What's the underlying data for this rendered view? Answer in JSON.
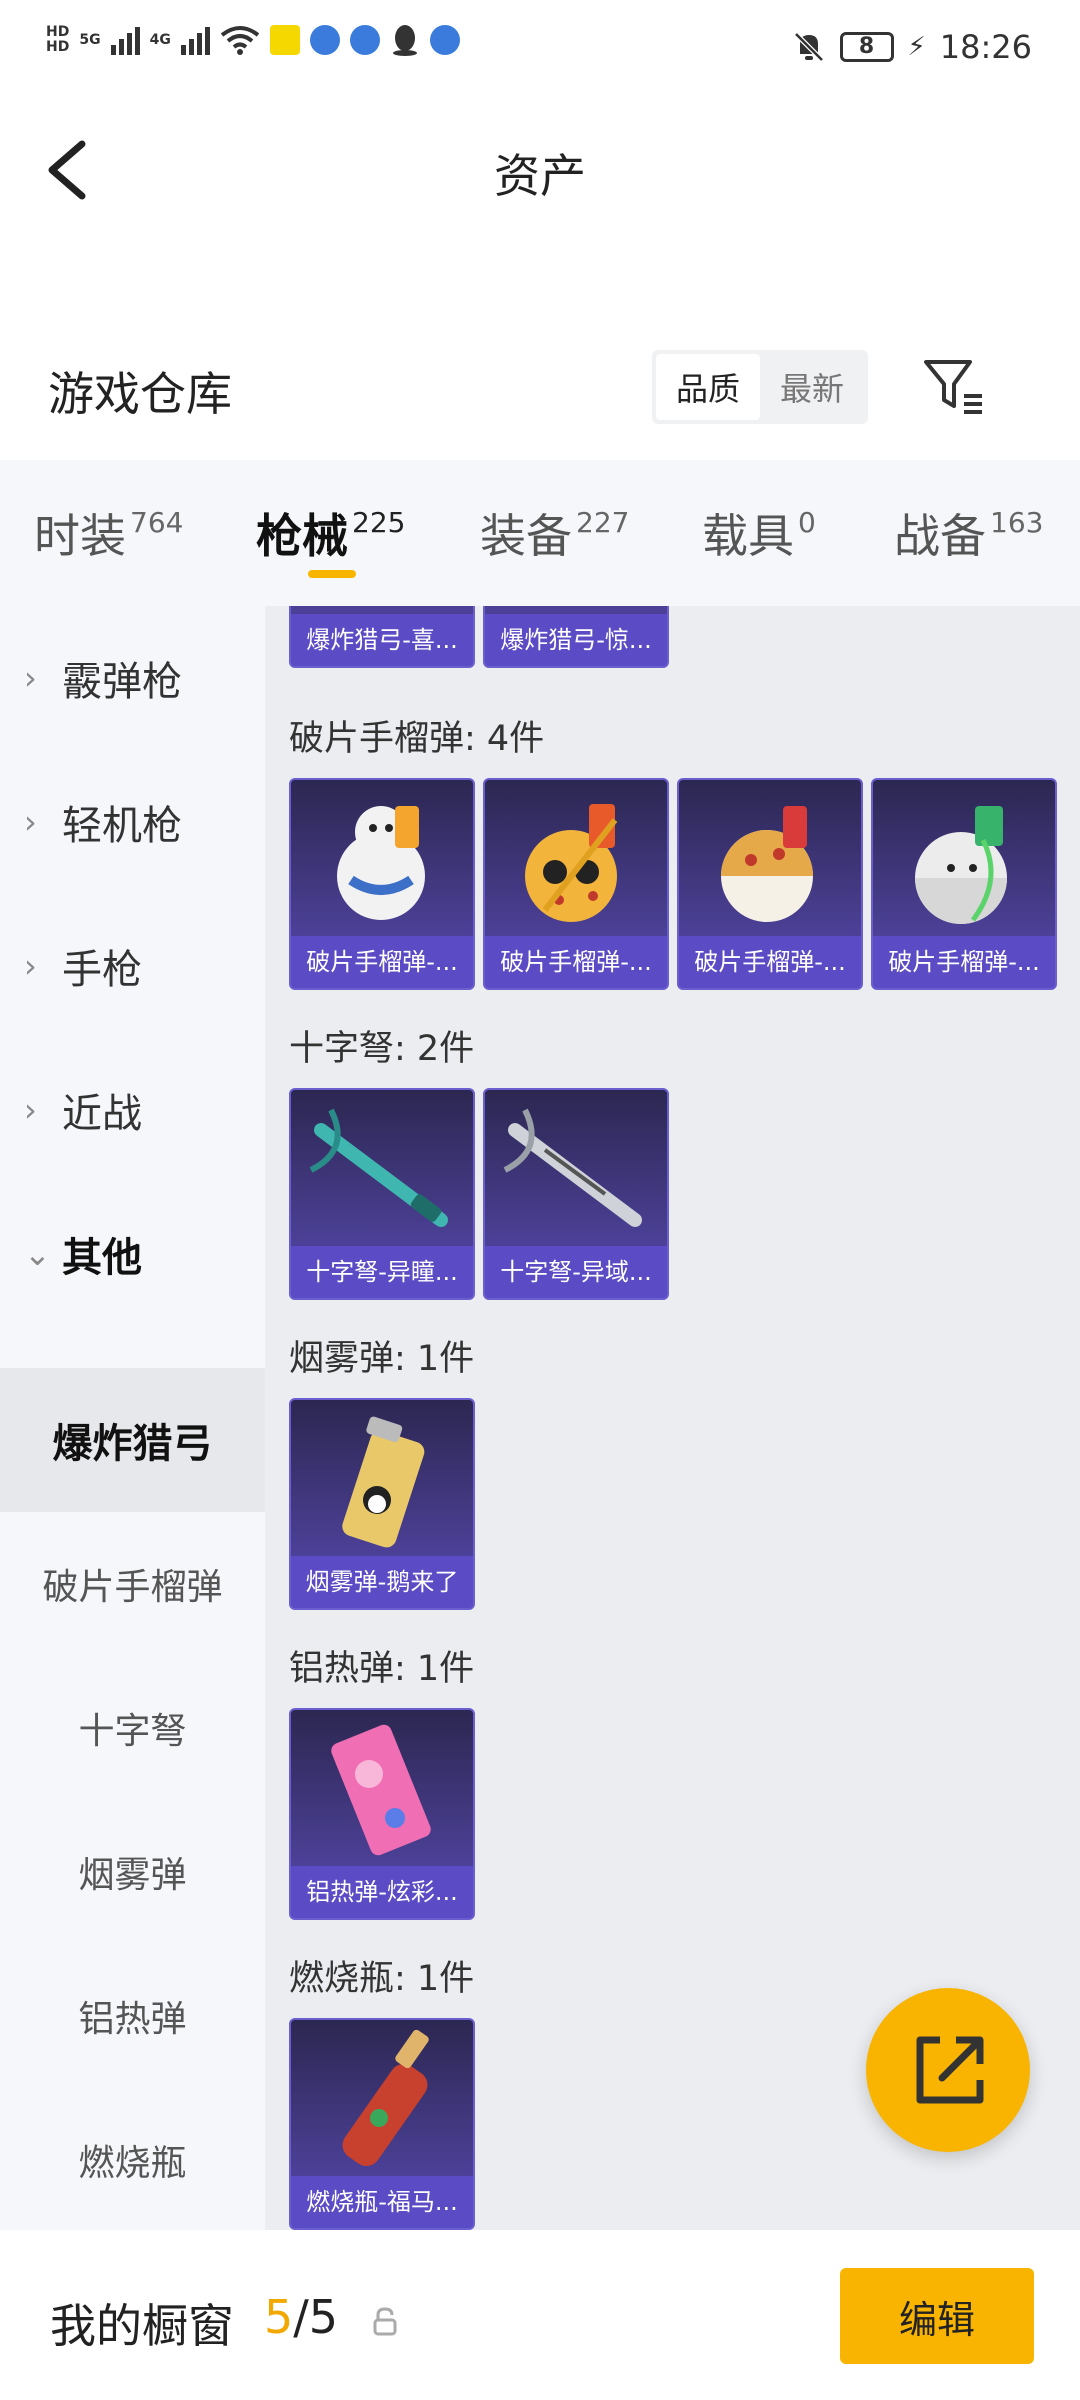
{
  "status_bar": {
    "hd1": "HD",
    "hd2": "HD",
    "net1": "5G",
    "net2": "4G",
    "time": "18:26",
    "battery": "8"
  },
  "header": {
    "title": "资产"
  },
  "section": {
    "title": "游戏仓库",
    "sort_quality": "品质",
    "sort_latest": "最新"
  },
  "tabs": [
    {
      "label": "时装",
      "count": "764"
    },
    {
      "label": "枪械",
      "count": "225"
    },
    {
      "label": "装备",
      "count": "227"
    },
    {
      "label": "载具",
      "count": "0"
    },
    {
      "label": "战备",
      "count": "163"
    }
  ],
  "sidebar": {
    "categories": [
      {
        "label": "霰弹枪",
        "arrow": "›"
      },
      {
        "label": "轻机枪",
        "arrow": "›"
      },
      {
        "label": "手枪",
        "arrow": "›"
      },
      {
        "label": "近战",
        "arrow": "›"
      },
      {
        "label": "其他",
        "arrow": "⌄"
      }
    ],
    "subitems": [
      "爆炸猎弓",
      "破片手榴弹",
      "十字弩",
      "烟雾弹",
      "铝热弹",
      "燃烧瓶"
    ]
  },
  "content": {
    "top_cards": [
      "爆炸猎弓-喜...",
      "爆炸猎弓-惊..."
    ],
    "groups": [
      {
        "title": "破片手榴弹: 4件",
        "items": [
          "破片手榴弹-...",
          "破片手榴弹-...",
          "破片手榴弹-...",
          "破片手榴弹-..."
        ]
      },
      {
        "title": "十字弩: 2件",
        "items": [
          "十字弩-异瞳...",
          "十字弩-异域..."
        ]
      },
      {
        "title": "烟雾弹: 1件",
        "items": [
          "烟雾弹-鹅来了"
        ]
      },
      {
        "title": "铝热弹: 1件",
        "items": [
          "铝热弹-炫彩..."
        ]
      },
      {
        "title": "燃烧瓶: 1件",
        "items": [
          "燃烧瓶-福马..."
        ]
      }
    ]
  },
  "bottom": {
    "title": "我的橱窗",
    "used": "5",
    "sep": "/",
    "total": "5",
    "edit": "编辑"
  }
}
